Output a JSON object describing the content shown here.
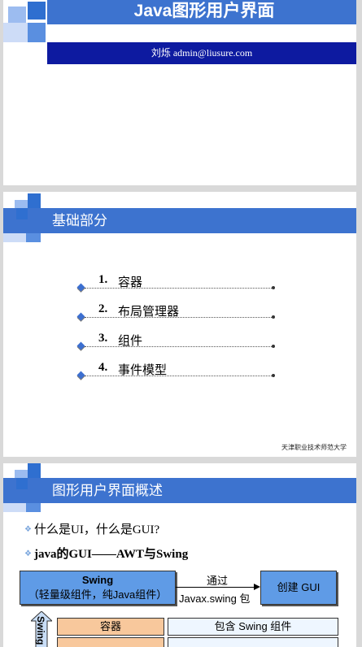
{
  "slide1": {
    "title": "Java图形用户界面",
    "author": "刘烁  admin@liusure.com"
  },
  "slide2": {
    "title": "基础部分",
    "items": [
      {
        "num": "1.",
        "label": "容器"
      },
      {
        "num": "2.",
        "label": "布局管理器"
      },
      {
        "num": "3.",
        "label": "组件"
      },
      {
        "num": "4.",
        "label": "事件模型"
      }
    ],
    "footer": "天津职业技术师范大学"
  },
  "slide3": {
    "title": "图形用户界面概述",
    "bullets": [
      "什么是UI，什么是GUI?",
      "java的GUI——AWT与Swing"
    ],
    "diagram": {
      "swing_title": "Swing",
      "swing_sub": "（轻量级组件，纯Java组件）",
      "arrow_top": "通过",
      "arrow_bottom": "Javax.swing 包",
      "create_gui": "创建 GUI",
      "container": "容器",
      "contains": "包含 Swing 组件",
      "vertical_label": "Swing"
    }
  },
  "colors": {
    "bar": "#3d73cf",
    "author_bar": "#0d1aa0",
    "box_blue": "#5f9be6",
    "box_orange": "#f8c89c"
  }
}
